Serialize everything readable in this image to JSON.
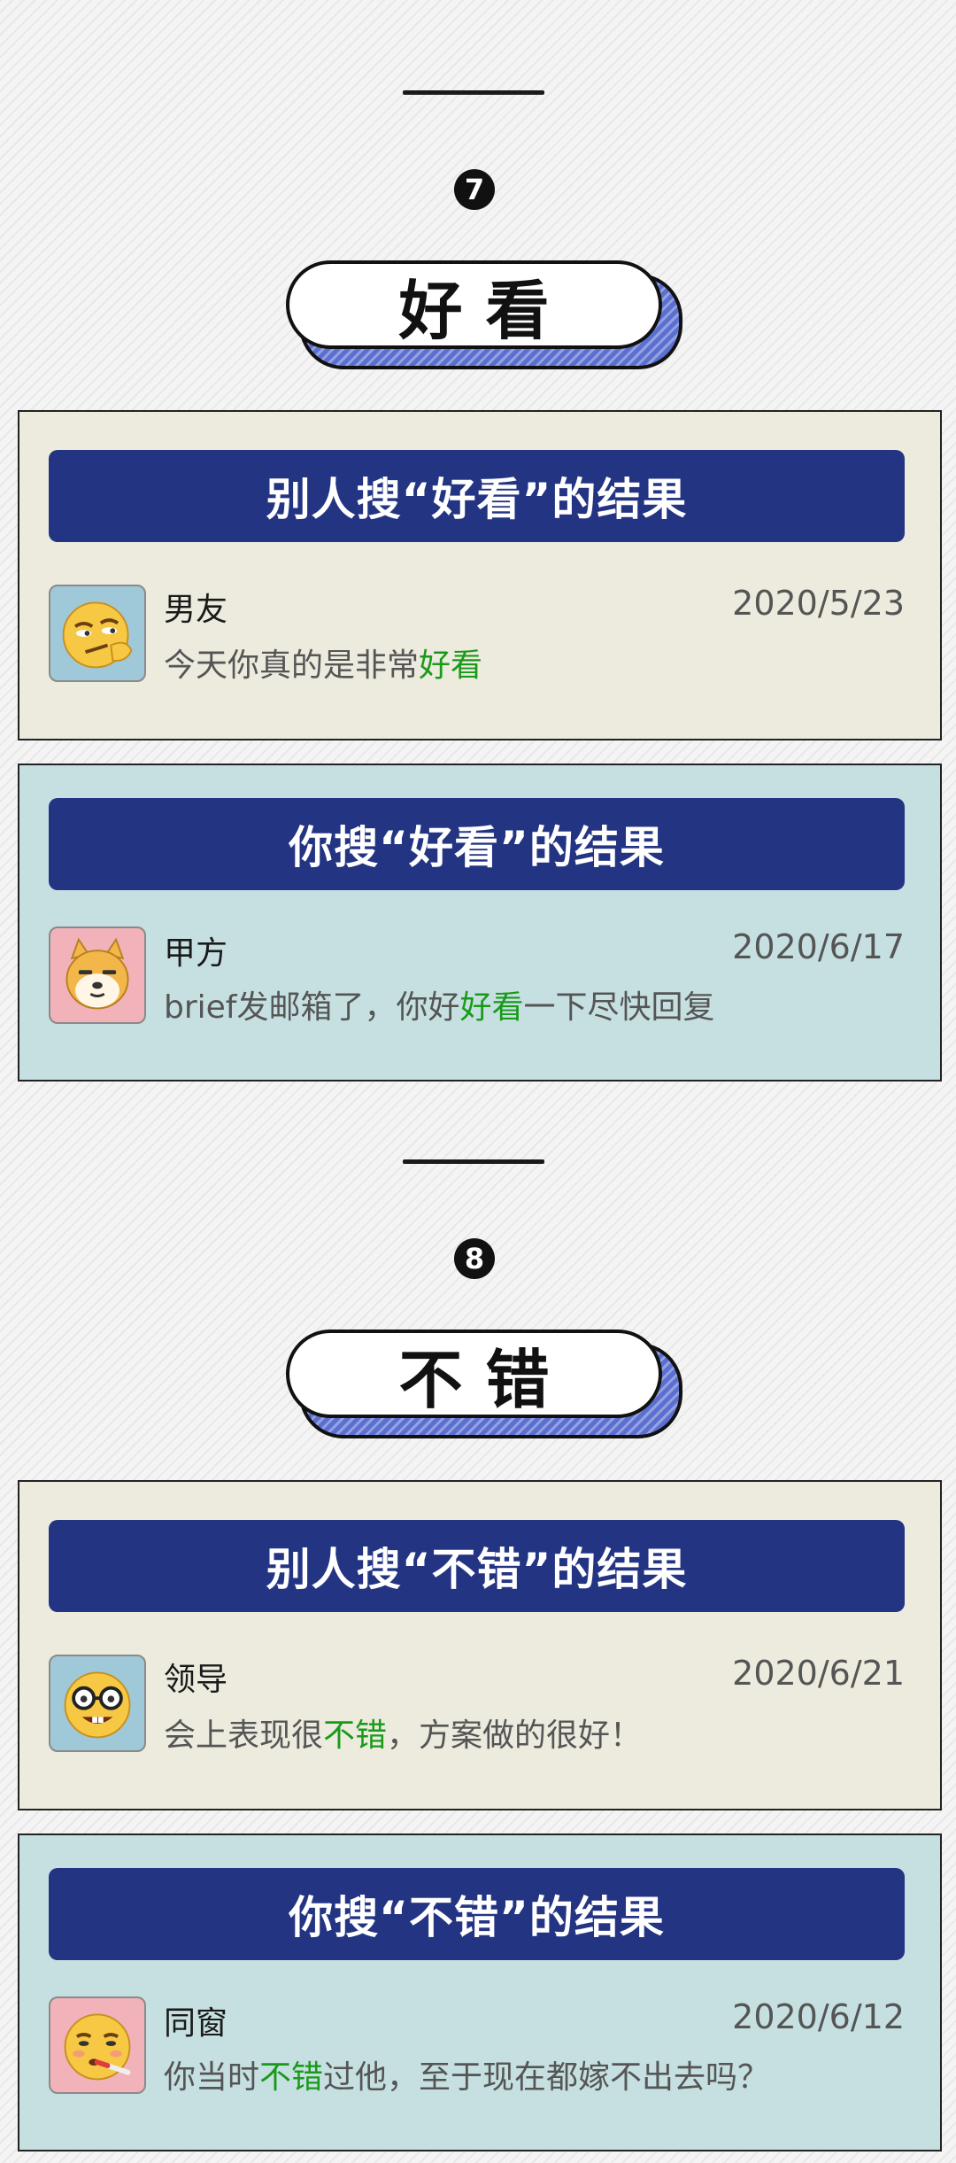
{
  "sections": [
    {
      "number": "7",
      "keyword": "好看",
      "cards": [
        {
          "header": "别人搜“好看”的结果",
          "sender": "男友",
          "date": "2020/5/23",
          "message_before": "今天你真的是非常",
          "message_highlight": "好看",
          "message_after": "",
          "avatar_icon": "smirk-emoji-icon"
        },
        {
          "header": "你搜“好看”的结果",
          "sender": "甲方",
          "date": "2020/6/17",
          "message_before": "brief发邮箱了，你好",
          "message_highlight": "好看",
          "message_after": "一下尽快回复",
          "avatar_icon": "doge-emoji-icon"
        }
      ]
    },
    {
      "number": "8",
      "keyword": "不错",
      "cards": [
        {
          "header": "别人搜“不错”的结果",
          "sender": "领导",
          "date": "2020/6/21",
          "message_before": "会上表现很",
          "message_highlight": "不错",
          "message_after": "，方案做的很好！",
          "avatar_icon": "nerd-glasses-emoji-icon"
        },
        {
          "header": "你搜“不错”的结果",
          "sender": "同窗",
          "date": "2020/6/12",
          "message_before": "你当时",
          "message_highlight": "不错",
          "message_after": "过他，至于现在都嫁不出去吗？",
          "avatar_icon": "thermometer-sick-emoji-icon"
        }
      ]
    }
  ],
  "colors": {
    "header_bg": "#233483",
    "card_beige": "#ecebde",
    "card_blue": "#c6e0e1",
    "highlight_green": "#1a9a1a",
    "pill_shadow": "#5b6fd0"
  }
}
